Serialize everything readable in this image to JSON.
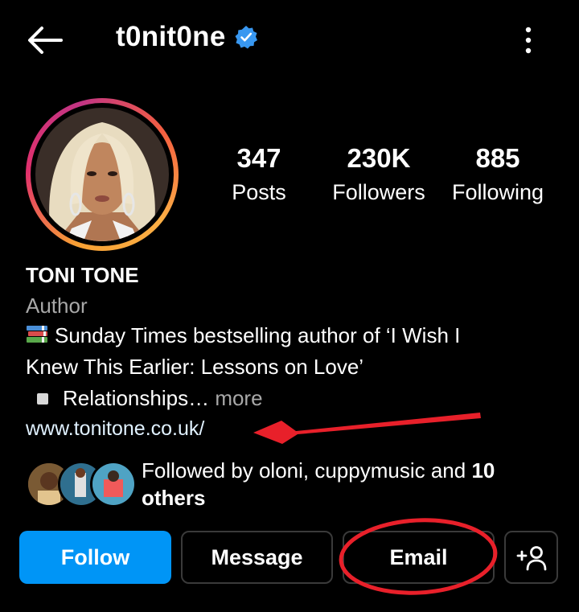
{
  "header": {
    "username": "t0nit0ne",
    "verified_icon": "verified-badge-icon",
    "back_icon": "arrow-left-icon",
    "more_icon": "more-vertical-icon"
  },
  "stats": {
    "posts": {
      "value": "347",
      "label": "Posts"
    },
    "followers": {
      "value": "230K",
      "label": "Followers"
    },
    "following": {
      "value": "885",
      "label": "Following"
    }
  },
  "bio": {
    "name": "TONI TONE",
    "category": "Author",
    "line1": "Sunday Times bestselling author of ‘I Wish I",
    "line2": "Knew This Earlier: Lessons on Love’",
    "line3": "Relationships…",
    "more": " more",
    "link": "www.tonitone.co.uk/"
  },
  "followed_by": {
    "prefix": "Followed by oloni, cuppymusic and ",
    "bold": "10",
    "suffix": "others"
  },
  "actions": {
    "follow": "Follow",
    "message": "Message",
    "email": "Email",
    "add_user_icon": "add-person-icon"
  },
  "colors": {
    "follow": "#0095f6",
    "verified": "#3897f0",
    "annotation": "#e8202a"
  }
}
